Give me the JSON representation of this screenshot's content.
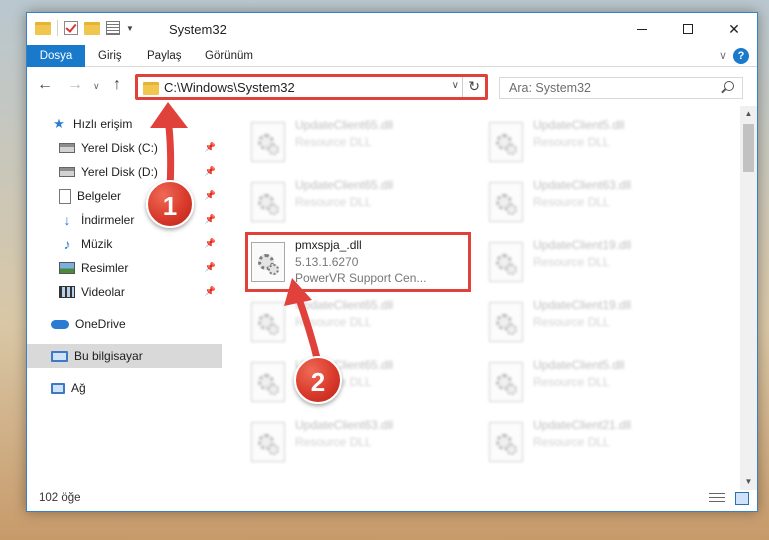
{
  "window": {
    "title": "System32",
    "minimize_label": "Simge durumuna küçült",
    "maximize_label": "Ekranı kapla",
    "close_label": "Kapat",
    "close_glyph": "✕"
  },
  "ribbon": {
    "tabs": [
      "Dosya",
      "Giriş",
      "Paylaş",
      "Görünüm"
    ],
    "expand_glyph": "∨",
    "help_glyph": "?"
  },
  "nav": {
    "back_glyph": "←",
    "forward_glyph": "→",
    "recent_glyph": "∨",
    "up_glyph": "↑",
    "address": "C:\\Windows\\System32",
    "address_dropdown_glyph": "∨",
    "refresh_glyph": "↻",
    "search_placeholder": "Ara: System32"
  },
  "sidebar": {
    "items": [
      {
        "label": "Hızlı erişim",
        "icon": "star-icon",
        "pinned": false
      },
      {
        "label": "Yerel Disk (C:)",
        "icon": "disk-icon",
        "pinned": true
      },
      {
        "label": "Yerel Disk (D:)",
        "icon": "disk-icon",
        "pinned": true
      },
      {
        "label": "Belgeler",
        "icon": "document-icon",
        "pinned": true
      },
      {
        "label": "İndirmeler",
        "icon": "download-icon",
        "pinned": true
      },
      {
        "label": "Müzik",
        "icon": "music-icon",
        "pinned": true
      },
      {
        "label": "Resimler",
        "icon": "pictures-icon",
        "pinned": true
      },
      {
        "label": "Videolar",
        "icon": "video-icon",
        "pinned": true
      },
      {
        "label": "OneDrive",
        "icon": "cloud-icon",
        "pinned": false
      },
      {
        "label": "Bu bilgisayar",
        "icon": "computer-icon",
        "pinned": false,
        "selected": true
      },
      {
        "label": "Ağ",
        "icon": "network-icon",
        "pinned": false
      }
    ],
    "pin_glyph": "📌",
    "star_glyph": "★",
    "download_glyph": "↓",
    "music_glyph": "♪"
  },
  "files": {
    "left_column": [
      {
        "name": "UpdateClient65.dll",
        "type": "Resource DLL",
        "blurred": true
      },
      {
        "name": "UpdateClient65.dll",
        "type": "Resource DLL",
        "blurred": true
      },
      {
        "name": "pmxspja_.dll",
        "version": "5.13.1.6270",
        "description": "PowerVR Support Cen...",
        "blurred": false
      },
      {
        "name": "UpdateClient65.dll",
        "type": "Resource DLL",
        "blurred": true
      },
      {
        "name": "UpdateClient65.dll",
        "type": "Resource DLL",
        "blurred": true
      },
      {
        "name": "UpdateClient63.dll",
        "type": "Resource DLL",
        "blurred": true
      }
    ],
    "right_column": [
      {
        "name": "UpdateClient5.dll",
        "type": "Resource DLL",
        "blurred": true
      },
      {
        "name": "UpdateClient63.dll",
        "type": "Resource DLL",
        "blurred": true
      },
      {
        "name": "UpdateClient19.dll",
        "type": "Resource DLL",
        "blurred": true
      },
      {
        "name": "UpdateClient19.dll",
        "type": "Resource DLL",
        "blurred": true
      },
      {
        "name": "UpdateClient5.dll",
        "type": "Resource DLL",
        "blurred": true
      },
      {
        "name": "UpdateClient21.dll",
        "type": "Resource DLL",
        "blurred": true
      }
    ]
  },
  "scrollbar": {
    "up_glyph": "▲",
    "down_glyph": "▼"
  },
  "status": {
    "item_count": "102 öğe"
  },
  "callouts": {
    "step1": "1",
    "step2": "2",
    "color": "#e0413b"
  }
}
